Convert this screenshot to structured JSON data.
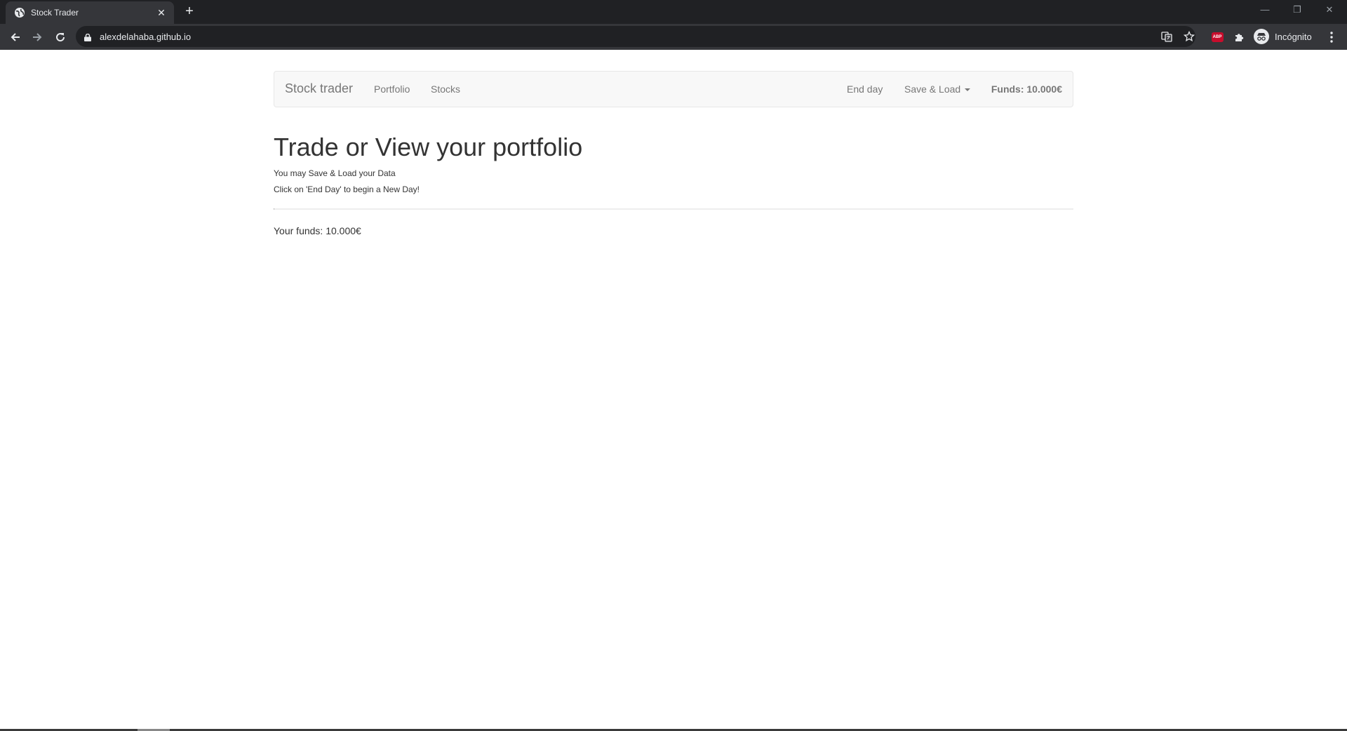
{
  "browser": {
    "tab_title": "Stock Trader",
    "url": "alexdelahaba.github.io",
    "profile_label": "Incógnito",
    "extension_abp_label": "ABP",
    "window_controls": [
      "minimize-icon",
      "restore-icon",
      "close-icon"
    ]
  },
  "navbar": {
    "brand": "Stock trader",
    "links": [
      "Portfolio",
      "Stocks"
    ],
    "end_day": "End day",
    "save_load": "Save & Load",
    "funds": "Funds: 10.000€"
  },
  "main": {
    "title": "Trade or View your portfolio",
    "line1": "You may Save & Load your Data",
    "line2": "Click on 'End Day' to begin a New Day!",
    "funds_text": "Your funds: 10.000€"
  },
  "colors": {
    "navbar_bg": "#f8f8f8",
    "navbar_text": "#777777",
    "body_text": "#333333",
    "chrome_dark": "#202124",
    "chrome_toolbar": "#35363a"
  }
}
